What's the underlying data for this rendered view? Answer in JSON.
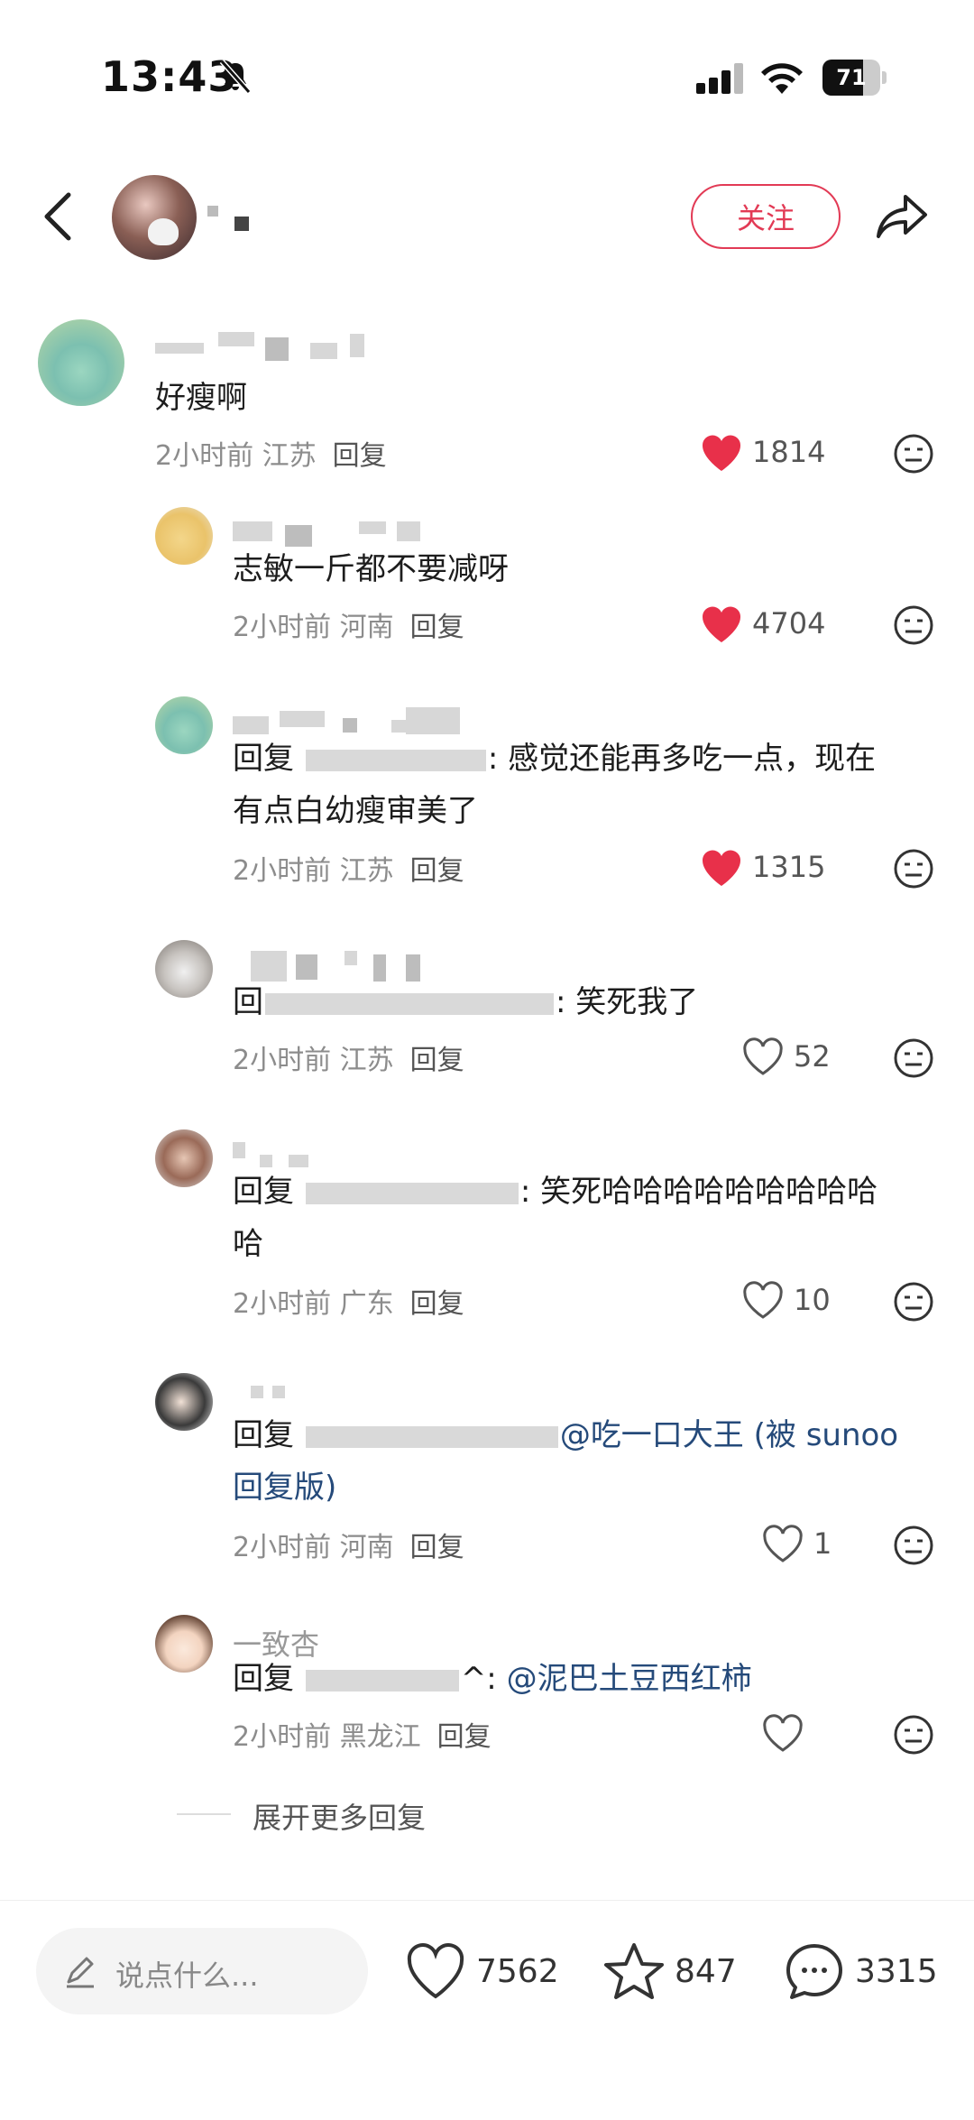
{
  "status_bar": {
    "time": "13:43",
    "battery": "71"
  },
  "header": {
    "follow_label": "关注"
  },
  "comments": [
    {
      "text": "好瘦啊",
      "time": "2小时前",
      "location": "江苏",
      "reply_label": "回复",
      "likes": "1814",
      "liked": true
    },
    {
      "text": "志敏一斤都不要减呀",
      "time": "2小时前",
      "location": "河南",
      "reply_label": "回复",
      "likes": "4704",
      "liked": true
    },
    {
      "reply_prefix": "回复",
      "text_tail": ": 感觉还能再多吃一点，现在",
      "text_line2": "有点白幼瘦审美了",
      "time": "2小时前",
      "location": "江苏",
      "reply_label": "回复",
      "likes": "1315",
      "liked": true
    },
    {
      "reply_prefix": "回",
      "text_tail": ": 笑死我了",
      "time": "2小时前",
      "location": "江苏",
      "reply_label": "回复",
      "likes": "52",
      "liked": false
    },
    {
      "reply_prefix": "回复",
      "text_tail": ": 笑死哈哈哈哈哈哈哈哈哈",
      "text_line2": "哈",
      "time": "2小时前",
      "location": "广东",
      "reply_label": "回复",
      "likes": "10",
      "liked": false
    },
    {
      "reply_prefix": "回复",
      "mention": "@吃一口大王 (被 sunoo",
      "text_line2": "回复版)",
      "time": "2小时前",
      "location": "河南",
      "reply_label": "回复",
      "likes": "1",
      "liked": false
    },
    {
      "username": "一致杏",
      "reply_prefix": "回复",
      "text_tail": "^: ",
      "mention": "@泥巴土豆西红柿",
      "time": "2小时前",
      "location": "黑龙江",
      "reply_label": "回复",
      "likes": "",
      "liked": false
    }
  ],
  "expand_more": "展开更多回复",
  "bottom_bar": {
    "input_placeholder": "说点什么...",
    "likes": "7562",
    "favorites": "847",
    "comments": "3315"
  },
  "colors": {
    "accent": "#e23a55",
    "like_red": "#e8304a",
    "mention": "#254a7a"
  }
}
